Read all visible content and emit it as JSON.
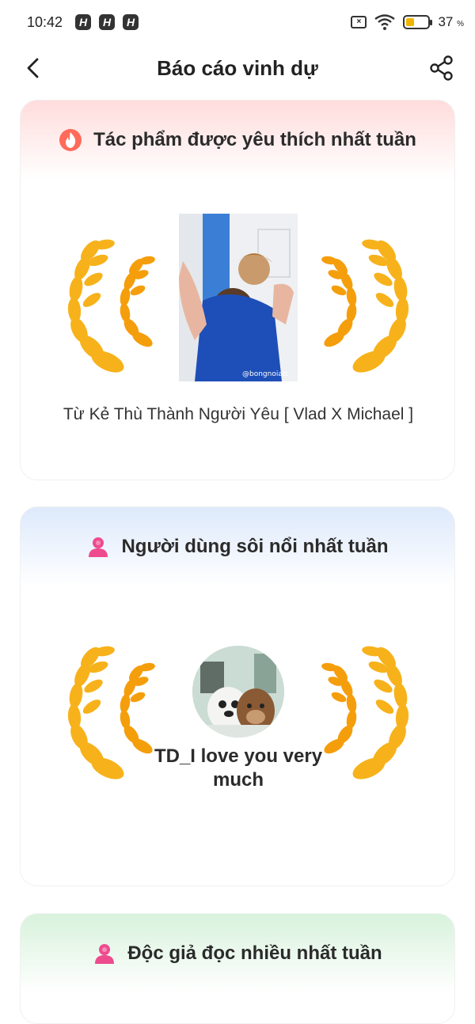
{
  "status_bar": {
    "time": "10:42",
    "battery_percent": "37",
    "battery_unit": "%",
    "battery_level": 0.37
  },
  "header": {
    "title": "Báo cáo vinh dự"
  },
  "sections": {
    "favorite_work": {
      "title": "Tác phẩm được yêu thích nhất tuần",
      "work_title": "Từ Kẻ Thù Thành Người Yêu [ Vlad X Michael ]",
      "cover_watermark": "@bongnoiatt"
    },
    "active_user": {
      "title": "Người dùng sôi nổi nhất tuần",
      "user_name": "TD_I love you very much"
    },
    "top_reader": {
      "title": "Độc giả đọc nhiều nhất tuần"
    }
  },
  "colors": {
    "red_header": "#ffdcdc",
    "blue_header": "#dde9fb",
    "green_header": "#d8f2dc",
    "wreath_gold": "#f7b21b",
    "person_pink": "#ee4b8f"
  },
  "icons": {
    "back": "chevron-left-icon",
    "share": "share-icon",
    "fire": "fire-icon",
    "person": "person-icon",
    "wreath": "laurel-wreath-icon"
  }
}
